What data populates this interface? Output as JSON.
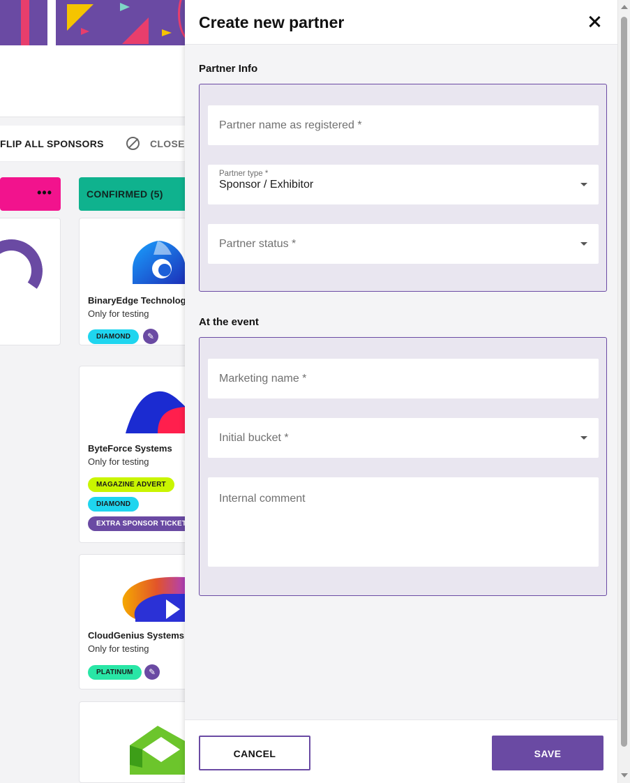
{
  "board": {
    "toolbar": {
      "flip_label": "FLIP ALL SPONSORS",
      "closed_label": "CLOSED"
    },
    "columns": {
      "left_menu_icon": "more-dots-icon",
      "confirmed_title": "CONFIRMED (5)"
    },
    "cards": [
      {
        "name": "BinaryEdge Technologies",
        "subtitle": "Only for testing",
        "tags": [
          "DIAMOND"
        ]
      },
      {
        "name": "ByteForce Systems",
        "subtitle": "Only for testing",
        "tags": [
          "MAGAZINE ADVERT",
          "DIAMOND",
          "EXTRA SPONSOR TICKET"
        ]
      },
      {
        "name": "CloudGenius Systems",
        "subtitle": "Only for testing",
        "tags": [
          "PLATINUM"
        ]
      },
      {
        "name": "",
        "subtitle": "",
        "tags": []
      }
    ]
  },
  "drawer": {
    "title": "Create new partner",
    "sections": {
      "partner_info": "Partner Info",
      "at_the_event": "At the event"
    },
    "fields": {
      "partner_name": {
        "placeholder": "Partner name as registered *",
        "value": ""
      },
      "partner_type": {
        "label": "Partner type *",
        "value": "Sponsor / Exhibitor"
      },
      "partner_status": {
        "placeholder": "Partner status *",
        "value": ""
      },
      "marketing_name": {
        "placeholder": "Marketing name *",
        "value": ""
      },
      "initial_bucket": {
        "placeholder": "Initial bucket *",
        "value": ""
      },
      "internal_comment": {
        "placeholder": "Internal comment",
        "value": ""
      }
    },
    "buttons": {
      "cancel": "CANCEL",
      "save": "SAVE"
    }
  },
  "colors": {
    "brand_purple": "#6a4aa3",
    "confirmed_green": "#0fb28e",
    "pink_column": "#f2138d",
    "panel_bg": "#e9e6f0",
    "diamond_chip": "#1fd5ef",
    "magazine_chip": "#c9f500",
    "platinum_chip": "#29e6a6"
  }
}
